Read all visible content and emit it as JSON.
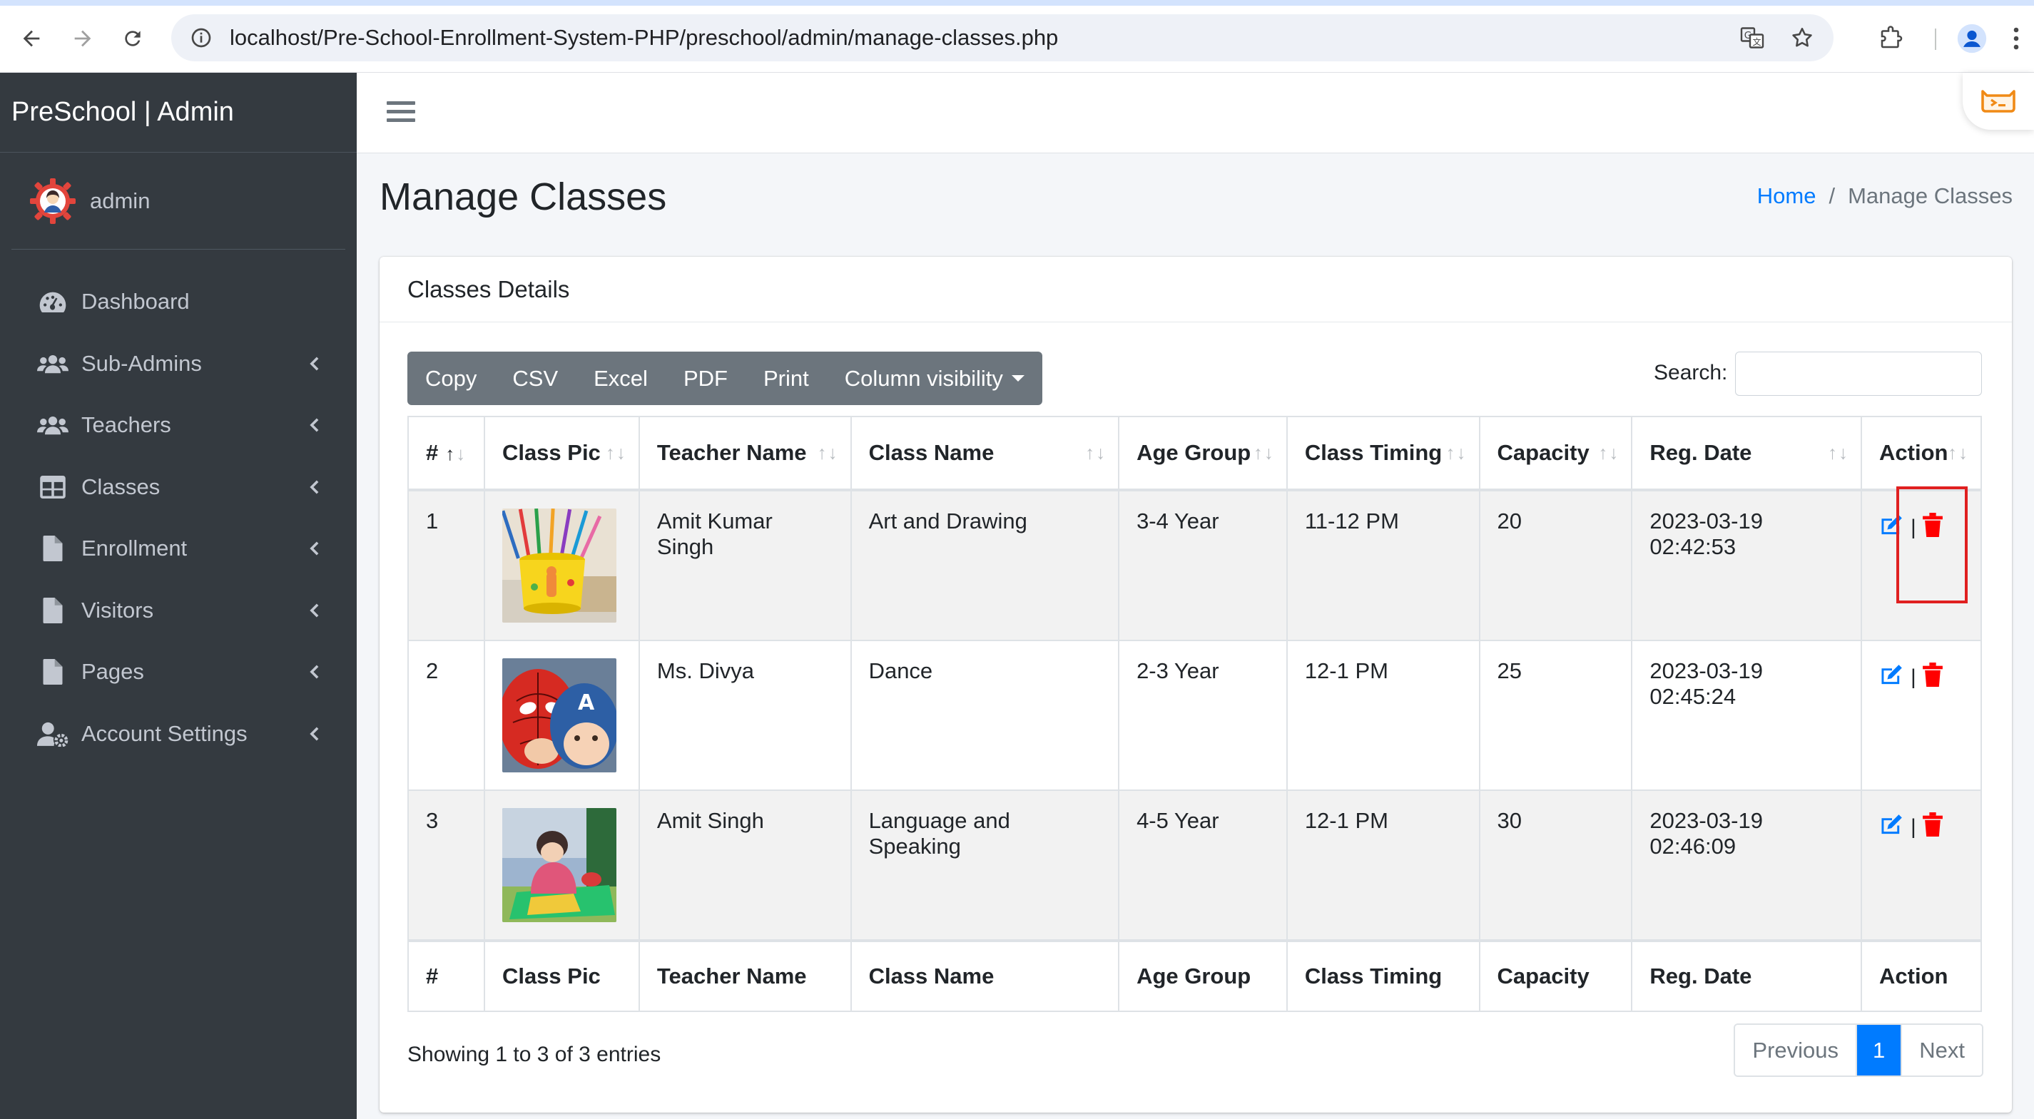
{
  "browser": {
    "url_host": "localhost",
    "url_path": "/Pre-School-Enrollment-System-PHP/preschool/admin/manage-classes.php"
  },
  "sidebar": {
    "brand": "PreSchool | Admin",
    "user": "admin",
    "items": [
      {
        "label": "Dashboard",
        "icon": "dashboard-icon",
        "has_children": false
      },
      {
        "label": "Sub-Admins",
        "icon": "users-icon",
        "has_children": true
      },
      {
        "label": "Teachers",
        "icon": "users-icon",
        "has_children": true
      },
      {
        "label": "Classes",
        "icon": "table-icon",
        "has_children": true
      },
      {
        "label": "Enrollment",
        "icon": "file-icon",
        "has_children": true
      },
      {
        "label": "Visitors",
        "icon": "file-icon",
        "has_children": true
      },
      {
        "label": "Pages",
        "icon": "file-icon",
        "has_children": true
      },
      {
        "label": "Account Settings",
        "icon": "user-cog-icon",
        "has_children": true
      }
    ]
  },
  "page": {
    "title": "Manage Classes",
    "breadcrumb_home": "Home",
    "breadcrumb_sep": "/",
    "breadcrumb_current": "Manage Classes"
  },
  "card": {
    "title": "Classes Details",
    "buttons": {
      "copy": "Copy",
      "csv": "CSV",
      "excel": "Excel",
      "pdf": "PDF",
      "print": "Print",
      "colvis": "Column visibility"
    },
    "search_label": "Search:",
    "search_value": ""
  },
  "table": {
    "columns": [
      "#",
      "Class Pic",
      "Teacher Name",
      "Class Name",
      "Age Group",
      "Class Timing",
      "Capacity",
      "Reg. Date",
      "Action"
    ],
    "rows": [
      {
        "num": "1",
        "pic": "pencil-cup",
        "teacher": "Amit Kumar Singh",
        "class": "Art and Drawing",
        "age": "3-4 Year",
        "timing": "11-12 PM",
        "capacity": "20",
        "date": "2023-03-19 02:42:53"
      },
      {
        "num": "2",
        "pic": "superhero-kids",
        "teacher": "Ms. Divya",
        "class": "Dance",
        "age": "2-3 Year",
        "timing": "12-1 PM",
        "capacity": "25",
        "date": "2023-03-19 02:45:24"
      },
      {
        "num": "3",
        "pic": "child-playing",
        "teacher": "Amit Singh",
        "class": "Language and Speaking",
        "age": "4-5 Year",
        "timing": "12-1 PM",
        "capacity": "30",
        "date": "2023-03-19 02:46:09"
      }
    ],
    "action_separator": "|"
  },
  "footer": {
    "info": "Showing 1 to 3 of 3 entries",
    "prev": "Previous",
    "page": "1",
    "next": "Next"
  },
  "colors": {
    "sidebar": "#343a40",
    "primary": "#007bff",
    "danger": "#ff0000",
    "highlight": "#e02020"
  }
}
